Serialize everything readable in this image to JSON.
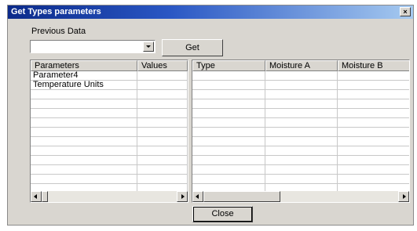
{
  "window": {
    "title": "Get Types parameters",
    "close_glyph": "×"
  },
  "previous_data": {
    "label": "Previous Data",
    "selected_value": ""
  },
  "buttons": {
    "get_label": "Get",
    "close_label": "Close"
  },
  "left_grid": {
    "columns": [
      "Parameters",
      "Values"
    ],
    "rows": [
      [
        "Parameter4",
        ""
      ],
      [
        "Temperature Units",
        ""
      ]
    ]
  },
  "right_grid": {
    "columns": [
      "Type",
      "Moisture A",
      "Moisture B"
    ],
    "rows": []
  }
}
